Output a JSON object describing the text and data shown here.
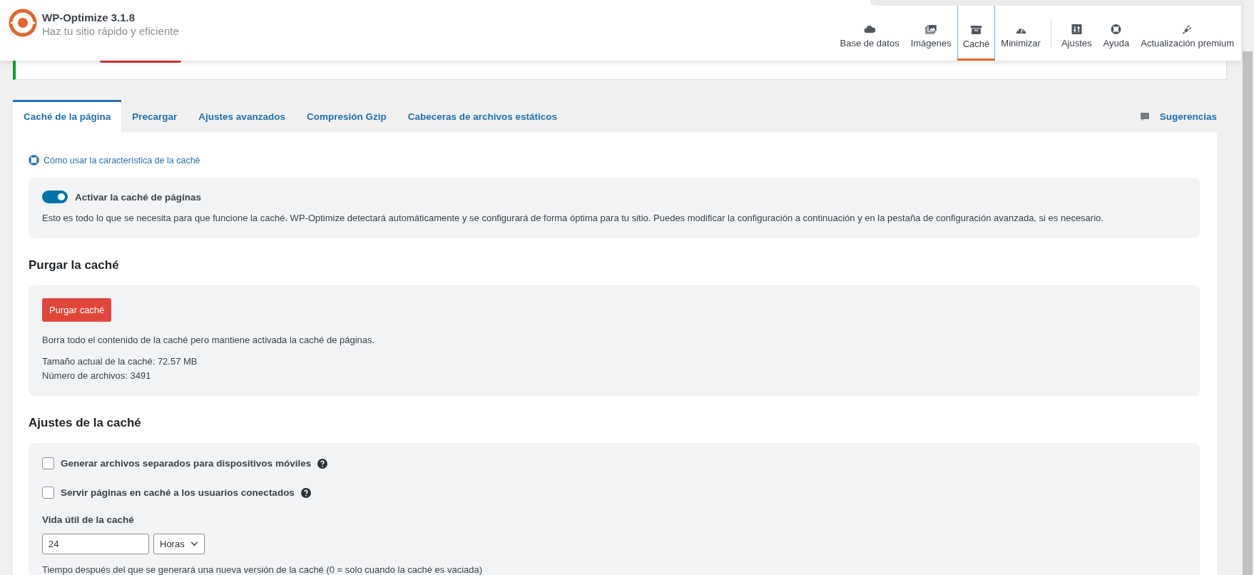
{
  "header": {
    "title": "WP-Optimize 3.1.8",
    "tagline": "Haz tu sitio rápido y eficiente"
  },
  "nav": [
    {
      "label": "Base de datos",
      "kind": "cloud",
      "selected": false,
      "separator_before": false
    },
    {
      "label": "Imágenes",
      "kind": "images",
      "selected": false,
      "separator_before": false
    },
    {
      "label": "Caché",
      "kind": "archive",
      "selected": true,
      "separator_before": false
    },
    {
      "label": "Minimizar",
      "kind": "gauge",
      "selected": false,
      "separator_before": false
    },
    {
      "label": "Ajustes",
      "kind": "sliders",
      "selected": false,
      "separator_before": true
    },
    {
      "label": "Ayuda",
      "kind": "lifebuoy",
      "selected": false,
      "separator_before": false
    },
    {
      "label": "Actualización premium",
      "kind": "plug",
      "selected": false,
      "separator_before": false
    }
  ],
  "tabs": [
    {
      "label": "Caché de la página",
      "selected": true
    },
    {
      "label": "Precargar",
      "selected": false
    },
    {
      "label": "Ajustes avanzados",
      "selected": false
    },
    {
      "label": "Compresión Gzip",
      "selected": false
    },
    {
      "label": "Cabeceras de archivos estáticos",
      "selected": false
    }
  ],
  "feedback": "Sugerencias",
  "help_link": "Cómo usar la característica de la caché",
  "enable": {
    "label": "Activar la caché de páginas",
    "on": true,
    "description": "Esto es todo lo que se necesita para que funcione la caché. WP-Optimize detectará automáticamente y se configurará de forma óptima para tu sitio. Puedes modificar la configuración a continuación y en la pestaña de configuración avanzada, si es necesario."
  },
  "purge": {
    "heading": "Purgar la caché",
    "button": "Purgar caché",
    "description": "Borra todo el contenido de la caché pero mantiene activada la caché de páginas.",
    "size": "Tamaño actual de la caché: 72.57 MB",
    "files": "Número de archivos: 3491"
  },
  "settings": {
    "heading": "Ajustes de la caché",
    "options": [
      {
        "label": "Generar archivos separados para dispositivos móviles",
        "checked": false
      },
      {
        "label": "Servir páginas en caché a los usuarios conectados",
        "checked": false
      }
    ],
    "lifespan": {
      "label": "Vida útil de la caché",
      "value": "24",
      "unit": "Horas",
      "hint": "Tiempo después del que se generará una nueva versión de la caché (0 = solo cuando la caché es vaciada)"
    }
  }
}
